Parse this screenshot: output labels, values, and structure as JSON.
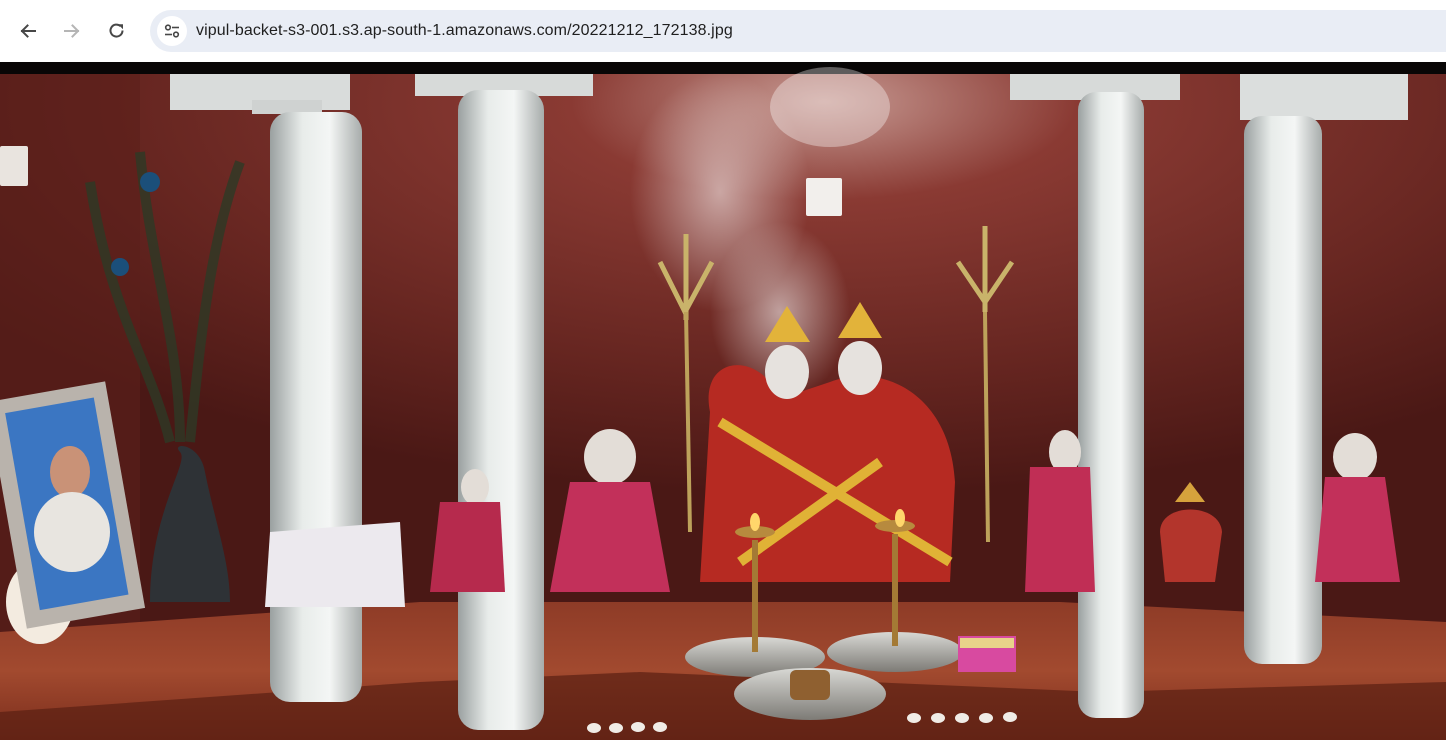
{
  "toolbar": {
    "back_icon": "arrow-left-icon",
    "forward_icon": "arrow-right-icon",
    "reload_icon": "reload-icon",
    "site_info_icon": "tune-icon"
  },
  "address_bar": {
    "url": "vipul-backet-s3-001.s3.ap-south-1.amazonaws.com/20221212_172138.jpg"
  },
  "viewer": {
    "image_alt": "20221212_172138.jpg"
  },
  "colors": {
    "toolbar_bg": "#ffffff",
    "omnibox_bg": "#e9edf5",
    "icon": "#474747",
    "icon_disabled": "#b5b5b5",
    "viewport_bg": "#000000"
  }
}
